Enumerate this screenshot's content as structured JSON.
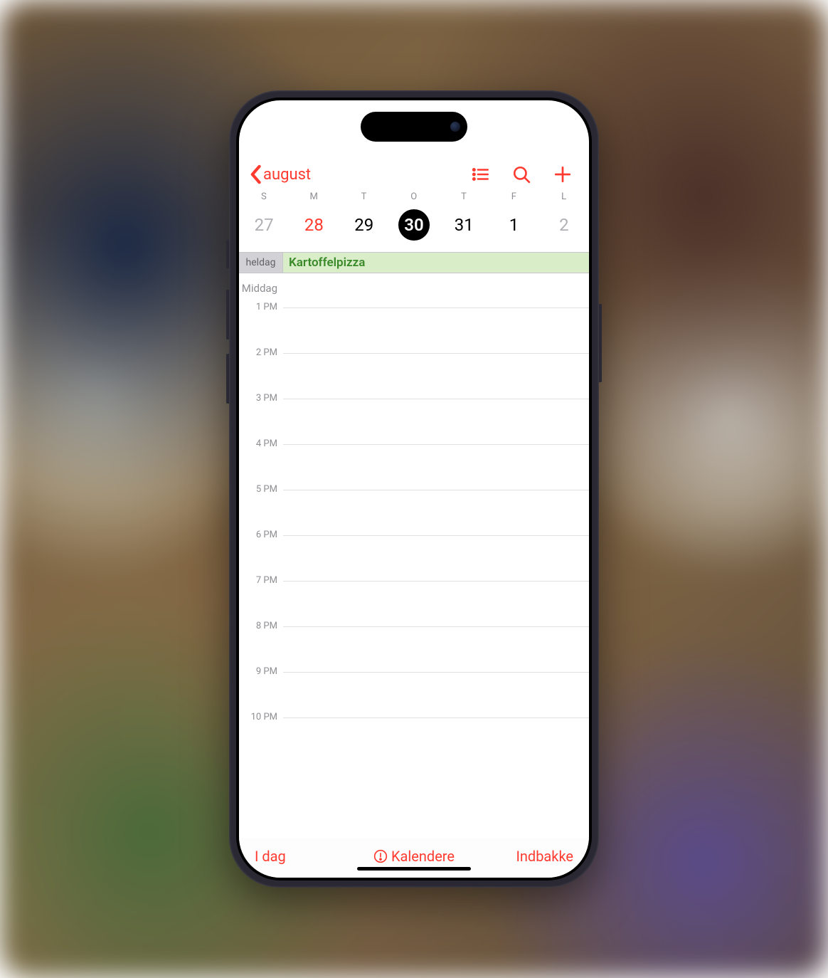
{
  "header": {
    "back_label": "august"
  },
  "week": {
    "days": [
      {
        "weekday": "S",
        "date": "27",
        "style": "muted"
      },
      {
        "weekday": "M",
        "date": "28",
        "style": "red"
      },
      {
        "weekday": "T",
        "date": "29",
        "style": "normal"
      },
      {
        "weekday": "O",
        "date": "30",
        "style": "selected"
      },
      {
        "weekday": "T",
        "date": "31",
        "style": "normal"
      },
      {
        "weekday": "F",
        "date": "1",
        "style": "normal"
      },
      {
        "weekday": "L",
        "date": "2",
        "style": "muted"
      }
    ]
  },
  "allday": {
    "label": "heldag",
    "event_title": "Kartoffelpizza"
  },
  "timeline": {
    "hours": [
      "Middag",
      "1 PM",
      "2 PM",
      "3 PM",
      "4 PM",
      "5 PM",
      "6 PM",
      "7 PM",
      "8 PM",
      "9 PM",
      "10 PM"
    ]
  },
  "toolbar": {
    "today": "I dag",
    "calendars": "Kalendere",
    "inbox": "Indbakke"
  },
  "colors": {
    "accent": "#ff3b30",
    "event_bg": "#d8edc8",
    "event_text": "#3a8a2a"
  }
}
